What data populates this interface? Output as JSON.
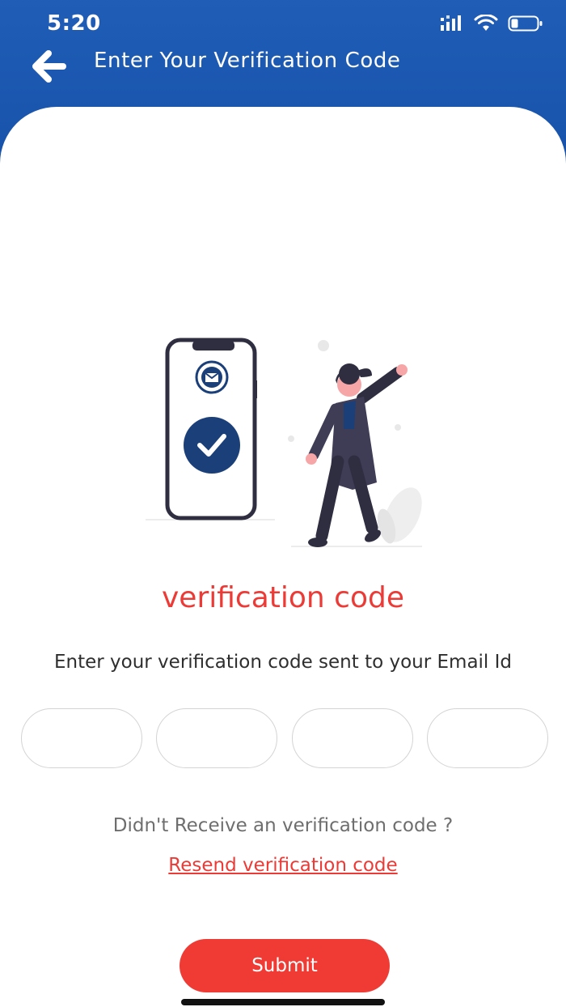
{
  "status_bar": {
    "time": "5:20",
    "icons": [
      "signal-icon",
      "wifi-icon",
      "battery-icon"
    ]
  },
  "app_bar": {
    "back_icon": "back-arrow-icon",
    "title": "Enter Your Verification Code"
  },
  "illustration": {
    "icons": [
      "envelope-icon",
      "check-icon"
    ]
  },
  "main": {
    "headline": "verification code",
    "subtitle": "Enter your verification code sent to your Email Id",
    "otp_fields": [
      {
        "value": "",
        "placeholder": ""
      },
      {
        "value": "",
        "placeholder": ""
      },
      {
        "value": "",
        "placeholder": ""
      },
      {
        "value": "",
        "placeholder": ""
      }
    ],
    "didnt_receive": "Didn't Receive an verification code ?",
    "resend_link": "Resend verification code",
    "submit_label": "Submit"
  },
  "colors": {
    "header_blue": "#1a56ae",
    "accent_red": "#ec3b36",
    "illustration_navy": "#1b3f79"
  }
}
